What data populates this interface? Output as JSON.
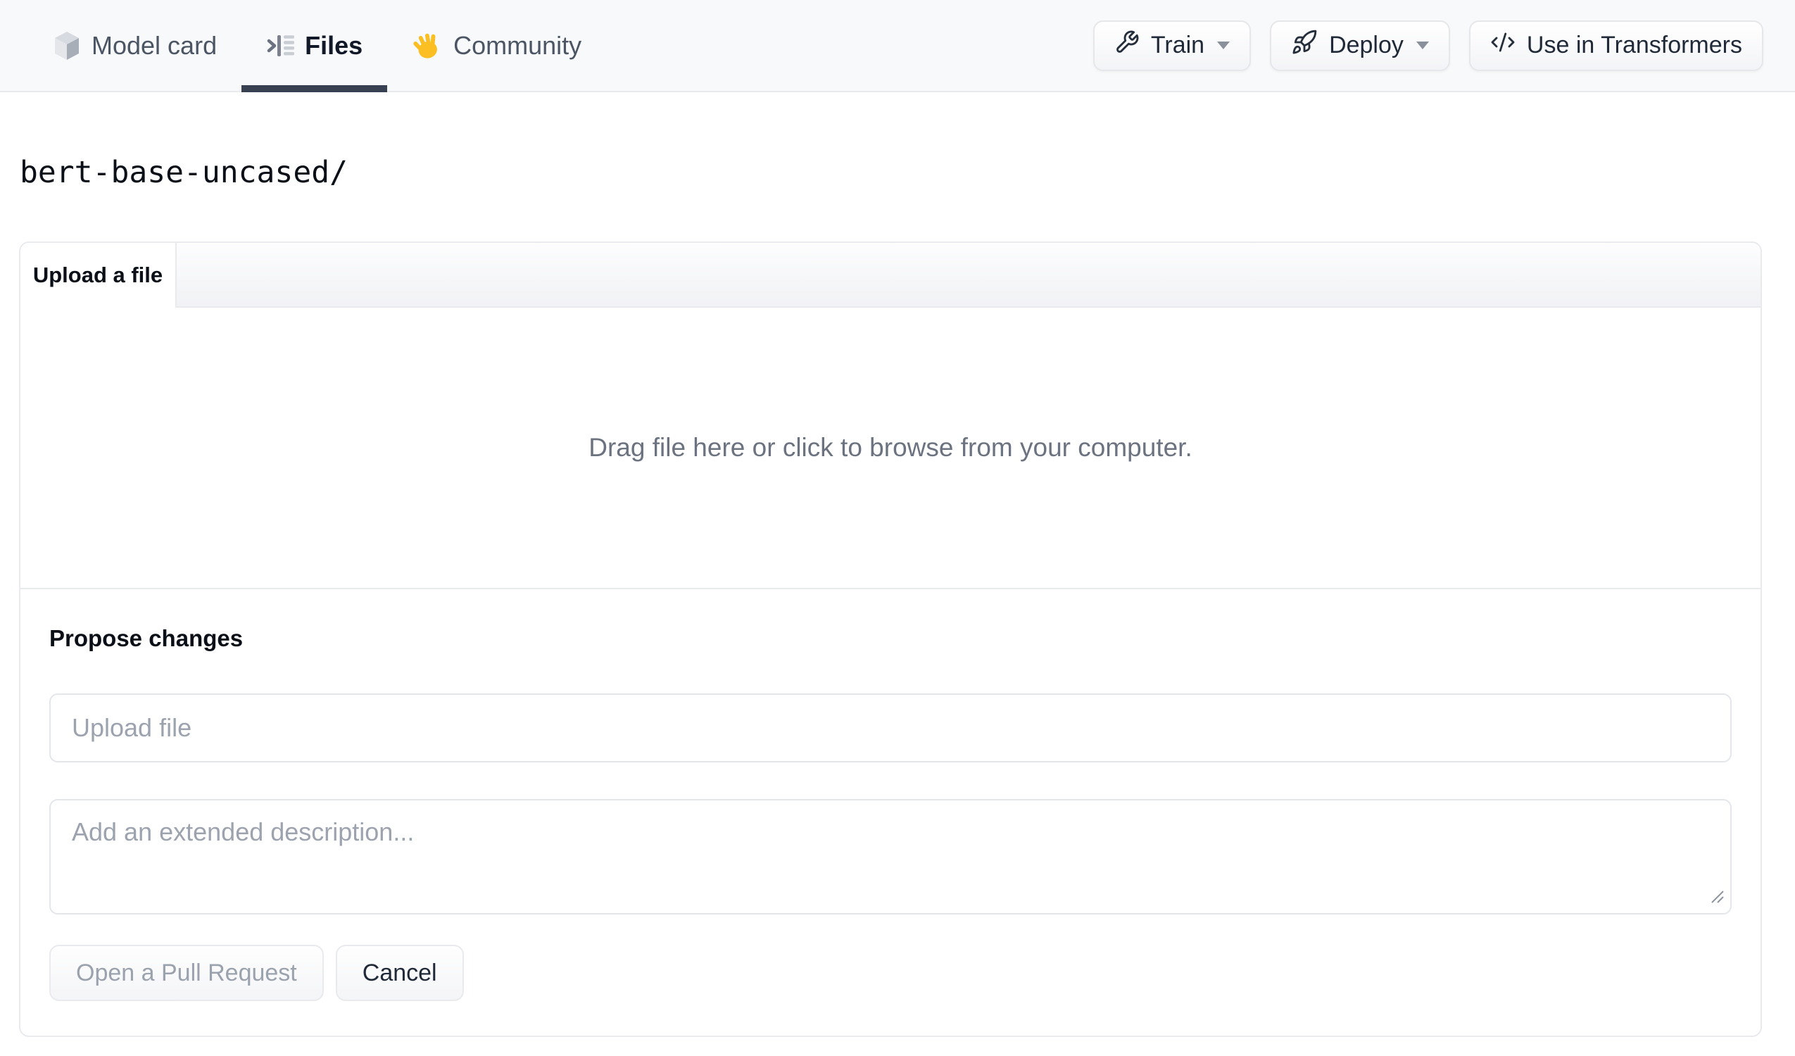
{
  "header": {
    "tabs": [
      {
        "label": "Model card",
        "icon": "cube-icon",
        "active": false
      },
      {
        "label": "Files",
        "icon": "file-list-icon",
        "active": true
      },
      {
        "label": "Community",
        "icon": "waving-hand-icon",
        "active": false
      }
    ],
    "actions": [
      {
        "label": "Train",
        "icon": "wrench-icon",
        "has_caret": true
      },
      {
        "label": "Deploy",
        "icon": "rocket-icon",
        "has_caret": true
      },
      {
        "label": "Use in Transformers",
        "icon": "code-icon",
        "has_caret": false
      }
    ]
  },
  "breadcrumb": {
    "path": "bert-base-uncased/"
  },
  "upload_card": {
    "tab_label": "Upload a file",
    "dropzone_text": "Drag file here or click to browse from your computer.",
    "propose_heading": "Propose changes",
    "file_input": {
      "value": "",
      "placeholder": "Upload file"
    },
    "description_input": {
      "value": "",
      "placeholder": "Add an extended description..."
    },
    "buttons": [
      {
        "label": "Open a Pull Request",
        "state": "disabled"
      },
      {
        "label": "Cancel",
        "state": "enabled"
      }
    ]
  },
  "colors": {
    "header_bg": "#f8f9fb",
    "active_tab_underline": "#374151",
    "card_border": "#e8eaee",
    "muted_text": "#6b7280",
    "placeholder_text": "#9ca3af",
    "hand_icon": "#fbbf24"
  }
}
